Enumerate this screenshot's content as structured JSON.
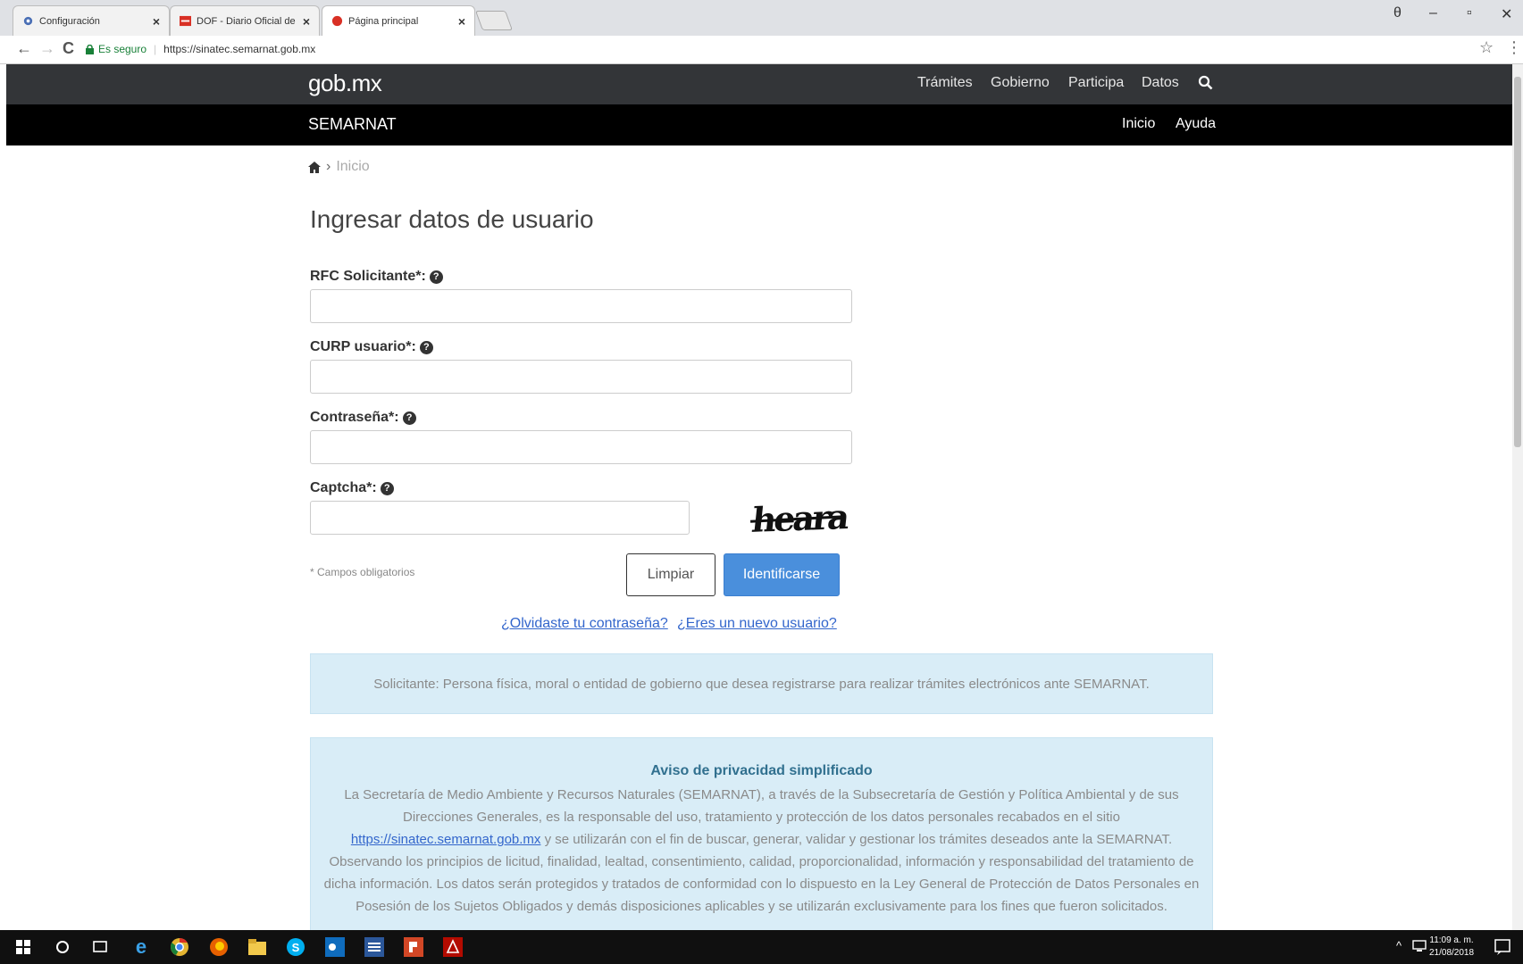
{
  "browser": {
    "tabs": [
      {
        "title": "Configuración",
        "favicon": "gear-icon",
        "color": "#4a6fb5"
      },
      {
        "title": "DOF - Diario Oficial de la",
        "favicon": "dof-icon",
        "color": "#d93025"
      },
      {
        "title": "Página principal",
        "favicon": "red-circle-icon",
        "color": "#d93025"
      }
    ],
    "tab_close": "×",
    "secure_label": "Es seguro",
    "url": "https://sinatec.semarnat.gob.mx",
    "window_controls": {
      "profile": "θ",
      "minimize": "–",
      "maximize": "▫",
      "close": "✕"
    },
    "nav": {
      "back": "←",
      "forward": "→",
      "reload": "C"
    },
    "bookmark_icon": "☆",
    "menu_icon": "⋮"
  },
  "header": {
    "logo": "gob.mx",
    "nav": [
      "Trámites",
      "Gobierno",
      "Participa",
      "Datos"
    ],
    "agency": "SEMARNAT",
    "subnav": [
      "Inicio",
      "Ayuda"
    ]
  },
  "breadcrumb": {
    "separator": "›",
    "current": "Inicio"
  },
  "form": {
    "title": "Ingresar datos de usuario",
    "fields": [
      {
        "label": "RFC Solicitante*:"
      },
      {
        "label": "CURP usuario*:"
      },
      {
        "label": "Contraseña*:"
      },
      {
        "label": "Captcha*:"
      }
    ],
    "help_glyph": "?",
    "captcha_text": "heara",
    "required_note": "* Campos obligatorios",
    "clear_button": "Limpiar",
    "login_button": "Identificarse",
    "forgot_link": "¿Olvidaste tu contraseña?",
    "new_user_link": "¿Eres un nuevo usuario?"
  },
  "info": {
    "text": "Solicitante: Persona física, moral o entidad de gobierno que desea registrarse para realizar trámites electrónicos ante SEMARNAT."
  },
  "privacy": {
    "title": "Aviso de privacidad simplificado",
    "text_before": "La Secretaría de Medio Ambiente y Recursos Naturales (SEMARNAT), a través de la Subsecretaría de Gestión y Política Ambiental y de sus Direcciones Generales, es la responsable del uso, tratamiento y protección de los datos personales recabados en el sitio ",
    "link": "https://sinatec.semarnat.gob.mx",
    "text_after": " y se utilizarán con el fin de buscar, generar, validar y gestionar los trámites deseados ante la SEMARNAT. Observando los principios de licitud, finalidad, lealtad, consentimiento, calidad, proporcionalidad, información y responsabilidad del tratamiento de dicha información. Los datos serán protegidos y tratados de conformidad con lo dispuesto en la Ley General de Protección de Datos Personales en Posesión de los Sujetos Obligados y demás disposiciones aplicables y se utilizarán exclusivamente para los fines que fueron solicitados."
  },
  "taskbar": {
    "time": "11:09 a. m.",
    "date": "21/08/2018"
  },
  "colors": {
    "brand_dark": "#333538",
    "accent": "#4a8fdc",
    "info_bg": "#d9edf7"
  }
}
